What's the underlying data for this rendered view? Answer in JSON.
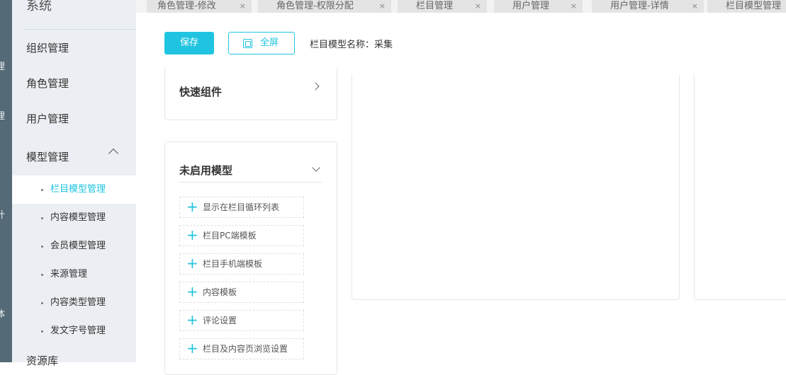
{
  "rail": [
    "理",
    "理",
    "计",
    "体"
  ],
  "sidebar": {
    "title": "系统",
    "items": [
      "组织管理",
      "角色管理",
      "用户管理",
      "模型管理"
    ],
    "sub": [
      "栏目模型管理",
      "内容模型管理",
      "会员模型管理",
      "来源管理",
      "内容类型管理",
      "发文字号管理"
    ],
    "next": "资源库"
  },
  "tabs": [
    "角色管理-修改",
    "角色管理-权限分配",
    "栏目管理",
    "用户管理",
    "用户管理-详情",
    "栏目模型管理"
  ],
  "toolbar": {
    "save": "保存",
    "fullscreen": "全屏",
    "model_name": "栏目模型名称：采集"
  },
  "quick": {
    "title": "快速组件"
  },
  "unused": {
    "title": "未启用模型",
    "items": [
      "显示在栏目循环列表",
      "栏目PC端模板",
      "栏目手机端模板",
      "内容模板",
      "评论设置",
      "栏目及内容页浏览设置"
    ]
  }
}
